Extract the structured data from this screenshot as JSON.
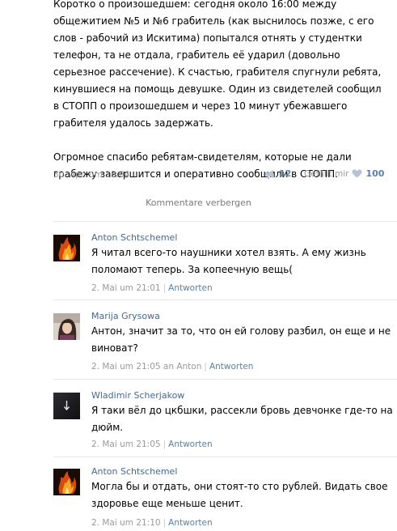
{
  "post": {
    "paragraph1": "Коротко о произошедшем: сегодня около 16:00 между общежитием №5 и №6 грабитель (как выснилось позже, с его слов - рабочий из Искитима) попытался отнять у студентки телефон, та не отдала, грабитель её ударил (довольно серьезное рассечение). К счастью, грабителя спугнули ребята, кинувшиеся на помощь девушке. Один из свидетелей сообщил в СТОПП о произошедшем и через 10 минут убежавшего грабителя удалось задержать.",
    "paragraph2": "Огромное спасибо ребятам-свидетелям, которые не дали грабежу завершится и оперативно сообщили в СТОПП.",
    "date": "30. Apr. um 18:04",
    "repost_count": "12",
    "like_label": "Gefällt mir",
    "like_count": "100"
  },
  "hide_comments_label": "Kommentare verbergen",
  "comments": [
    {
      "author": "Anton Schtschemel",
      "text": "Я читал всего-то наушники хотел взять. А ему жизнь поломают теперь. За копеечную вещь(",
      "date": "2. Mai um 21:01",
      "reply_label": "Antworten",
      "avatar": "avatar-fire"
    },
    {
      "author": "Marija Grysowa",
      "text": "Антон, значит за то, что он ей голову разбил, он еще и не виноват?",
      "date": "2. Mai um 21:05 an Anton",
      "reply_label": "Antworten",
      "avatar": "avatar-girl"
    },
    {
      "author": "Wladimir Scherjakow",
      "text": "Я таки вёл до цкбшки, рассекли бровь девчонке где-то на дюйм.",
      "date": "2. Mai um 21:05",
      "reply_label": "Antworten",
      "avatar": "avatar-dark"
    },
    {
      "author": "Anton Schtschemel",
      "text": "Могла бы и отдать, они стоят-то сто рублей. Видать свое здоровье еще меньше ценит.",
      "date": "2. Mai um 21:10",
      "reply_label": "Antworten",
      "avatar": "avatar-fire"
    }
  ],
  "colors": {
    "link": "#45688e",
    "meta": "#9a9a9a",
    "count": "#5b7fa6",
    "divider": "#e3e6ea"
  }
}
